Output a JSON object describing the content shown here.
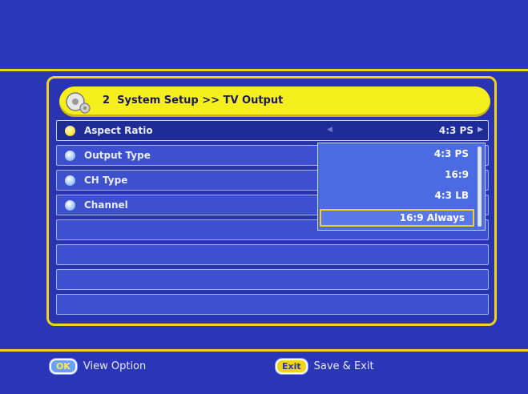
{
  "header": {
    "menu_number": "2",
    "title": "System Setup >> TV Output"
  },
  "settings": [
    {
      "label": "Aspect Ratio",
      "value": "4:3 PS",
      "icon": "yellow-dot-icon",
      "selected": true
    },
    {
      "label": "Output Type",
      "icon": "blue-dot-icon"
    },
    {
      "label": "CH Type",
      "icon": "blue-dot-icon"
    },
    {
      "label": "Channel",
      "icon": "blue-dot-icon"
    }
  ],
  "dropdown": {
    "options": [
      "4:3 PS",
      "16:9",
      "4:3 LB",
      "16:9 Always"
    ],
    "highlighted": "16:9 Always"
  },
  "footer": {
    "ok_key": "OK",
    "ok_label": "View Option",
    "exit_key": "Exit",
    "exit_label": "Save & Exit"
  },
  "colors": {
    "background": "#2a35b8",
    "accent": "#f2d21a",
    "title_bar": "#f5ef1e"
  }
}
